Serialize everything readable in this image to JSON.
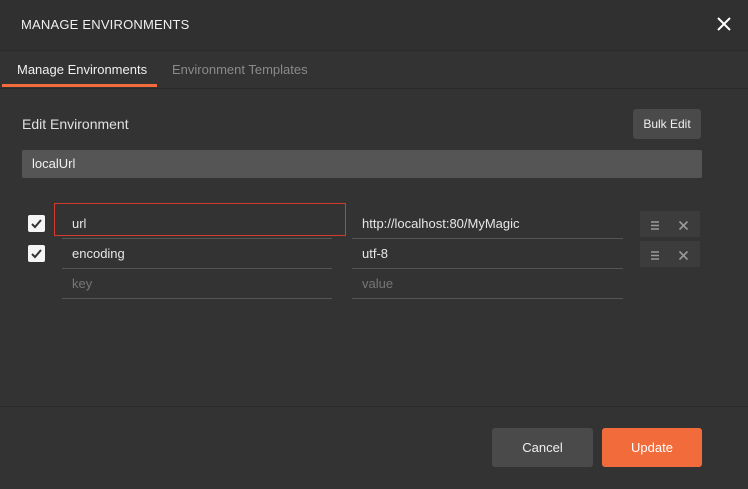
{
  "modal": {
    "title": "MANAGE ENVIRONMENTS"
  },
  "tabs": [
    {
      "label": "Manage Environments",
      "active": true
    },
    {
      "label": "Environment Templates",
      "active": false
    }
  ],
  "edit": {
    "section_label": "Edit Environment",
    "bulk_edit_label": "Bulk Edit",
    "env_name": "localUrl"
  },
  "variables": [
    {
      "enabled": true,
      "key": "url",
      "value": "http://localhost:80/MyMagic"
    },
    {
      "enabled": true,
      "key": "encoding",
      "value": "utf-8"
    }
  ],
  "new_row": {
    "key_placeholder": "key",
    "value_placeholder": "value"
  },
  "footer": {
    "cancel_label": "Cancel",
    "update_label": "Update"
  },
  "colors": {
    "accent": "#f26b3a",
    "highlight_border": "#d53a2e",
    "background": "#333333"
  }
}
